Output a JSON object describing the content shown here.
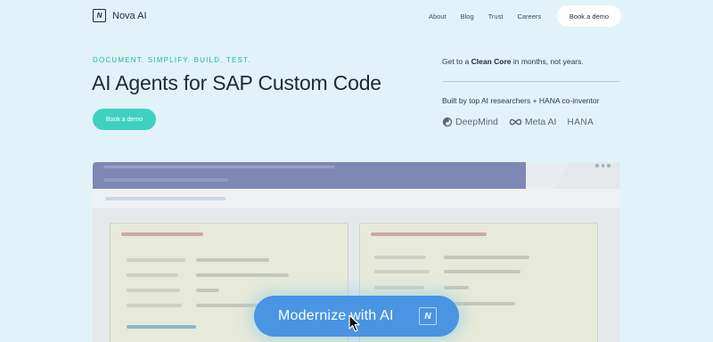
{
  "brand": {
    "name": "Nova AI",
    "logo_glyph": "N",
    "icon": "nova-logo-icon"
  },
  "nav": {
    "links": [
      "About",
      "Blog",
      "Trust",
      "Careers"
    ],
    "cta_label": "Book a demo"
  },
  "hero": {
    "kicker": "DOCUMENT. SIMPLIFY. BUILD. TEST.",
    "headline": "AI Agents for SAP Custom Code",
    "cta_label": "Book a demo"
  },
  "right": {
    "tagline_prefix": "Get to a ",
    "tagline_bold": "Clean Core",
    "tagline_suffix": " in months, not years.",
    "built_by": "Built by top AI researchers + HANA co-inventor",
    "brands": [
      {
        "name": "DeepMind",
        "icon": "deepmind-icon"
      },
      {
        "name": "Meta AI",
        "icon": "meta-infinity-icon"
      },
      {
        "name": "HANA",
        "icon": ""
      }
    ]
  },
  "action": {
    "label": "Modernize with AI",
    "logo_glyph": "N"
  },
  "colors": {
    "background": "#e1f3f9",
    "accent_teal": "#3fd1c0",
    "cta_blue": "#4a94e4",
    "mock_header": "#7d88b4"
  }
}
